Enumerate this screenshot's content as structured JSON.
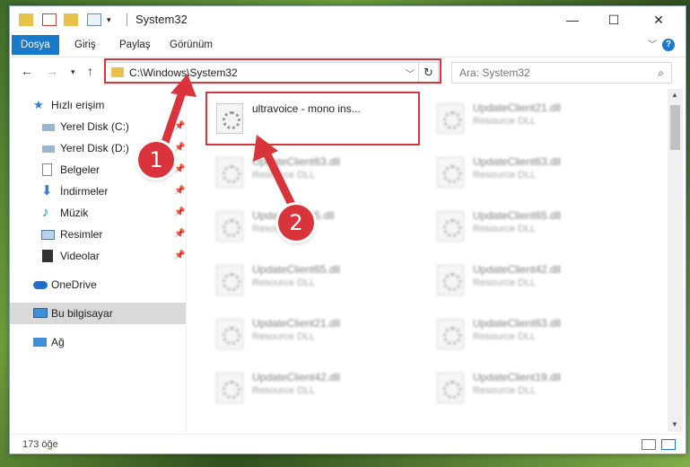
{
  "window": {
    "title": "System32"
  },
  "ribbon": {
    "tabs": [
      "Dosya",
      "Giriş",
      "Paylaş",
      "Görünüm"
    ]
  },
  "address": {
    "path": "C:\\Windows\\System32"
  },
  "search": {
    "placeholder": "Ara: System32"
  },
  "sidebar": {
    "items": [
      {
        "label": "Hızlı erişim"
      },
      {
        "label": "Yerel Disk (C:)"
      },
      {
        "label": "Yerel Disk (D:)"
      },
      {
        "label": "Belgeler"
      },
      {
        "label": "İndirmeler"
      },
      {
        "label": "Müzik"
      },
      {
        "label": "Resimler"
      },
      {
        "label": "Videolar"
      },
      {
        "label": "OneDrive"
      },
      {
        "label": "Bu bilgisayar"
      },
      {
        "label": "Ağ"
      }
    ]
  },
  "files": {
    "highlighted": {
      "name": "ultravoice - mono ins..."
    },
    "items": [
      {
        "name": "UpdateClient21.dll",
        "type": "Resource DLL"
      },
      {
        "name": "UpdateClient63.dll",
        "type": "Resource DLL"
      },
      {
        "name": "UpdateClient63.dll",
        "type": "Resource DLL"
      },
      {
        "name": "UpdateClient5.dll",
        "type": "Resource DLL"
      },
      {
        "name": "UpdateClient65.dll",
        "type": "Resource DLL"
      },
      {
        "name": "UpdateClient65.dll",
        "type": "Resource DLL"
      },
      {
        "name": "UpdateClient42.dll",
        "type": "Resource DLL"
      },
      {
        "name": "UpdateClient21.dll",
        "type": "Resource DLL"
      },
      {
        "name": "UpdateClient63.dll",
        "type": "Resource DLL"
      },
      {
        "name": "UpdateClient42.dll",
        "type": "Resource DLL"
      },
      {
        "name": "UpdateClient19.dll",
        "type": "Resource DLL"
      }
    ]
  },
  "status": {
    "count": "173 öğe"
  },
  "annotations": {
    "step1": "1",
    "step2": "2"
  },
  "colors": {
    "accent": "#1979ca",
    "highlight": "#d9343b"
  }
}
